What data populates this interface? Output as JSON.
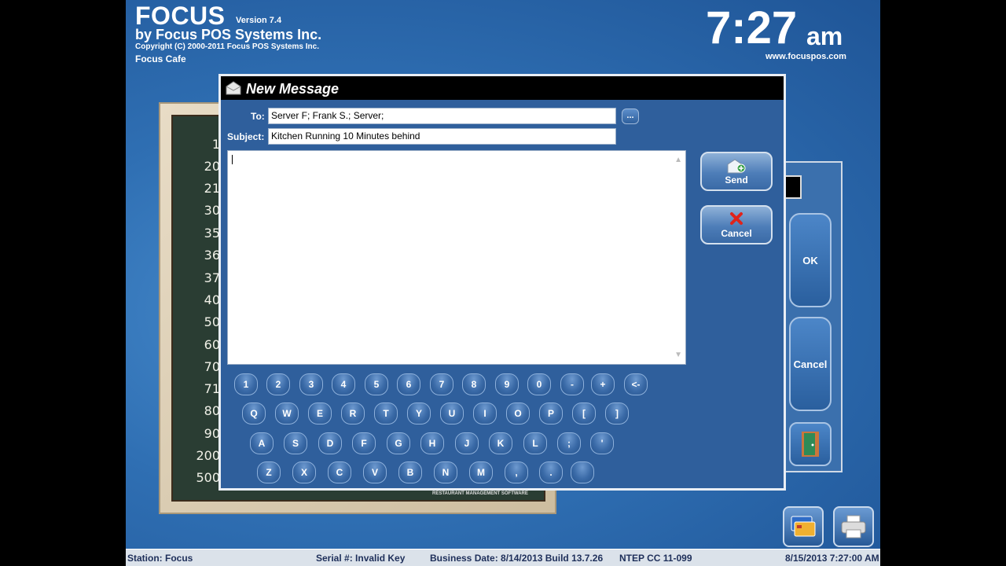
{
  "header": {
    "app_name": "FOCUS",
    "version": "Version 7.4",
    "vendor": "by Focus POS Systems Inc.",
    "copyright": "Copyright (C) 2000-2011 Focus POS Systems Inc.",
    "store": "Focus Cafe",
    "time": "7:27",
    "ampm": "am",
    "website": "www.focuspos.com"
  },
  "chalkboard": {
    "numbers": [
      "1",
      "20",
      "21",
      "30",
      "35",
      "36",
      "37",
      "40",
      "50",
      "60",
      "70",
      "71",
      "80",
      "90",
      "200",
      "500"
    ],
    "footer": "RESTAURANT MANAGEMENT SOFTWARE"
  },
  "dialog": {
    "title": "New Message",
    "to_label": "To:",
    "to_value": "Server F; Frank S.; Server;",
    "subject_label": "Subject:",
    "subject_value": "Kitchen Running 10 Minutes behind",
    "browse_label": "...",
    "body": "",
    "send_label": "Send",
    "cancel_label": "Cancel"
  },
  "keyboard": {
    "row1": [
      "1",
      "2",
      "3",
      "4",
      "5",
      "6",
      "7",
      "8",
      "9",
      "0",
      "-",
      "+",
      "<-"
    ],
    "row2": [
      "Q",
      "W",
      "E",
      "R",
      "T",
      "Y",
      "U",
      "I",
      "O",
      "P",
      "[",
      "]"
    ],
    "row3": [
      "A",
      "S",
      "D",
      "F",
      "G",
      "H",
      "J",
      "K",
      "L",
      ";",
      "'"
    ],
    "row4": [
      "Z",
      "X",
      "C",
      "V",
      "B",
      "N",
      "M",
      ",",
      ".",
      ""
    ]
  },
  "right_panel": {
    "ok_label": "OK",
    "cancel_label": "Cancel"
  },
  "status_bar": {
    "station": "Station: Focus",
    "serial": "Serial #: Invalid Key",
    "business_date": "Business Date: 8/14/2013 Build 13.7.26",
    "ntep": "NTEP CC 11-099",
    "datetime": "8/15/2013 7:27:00 AM"
  }
}
